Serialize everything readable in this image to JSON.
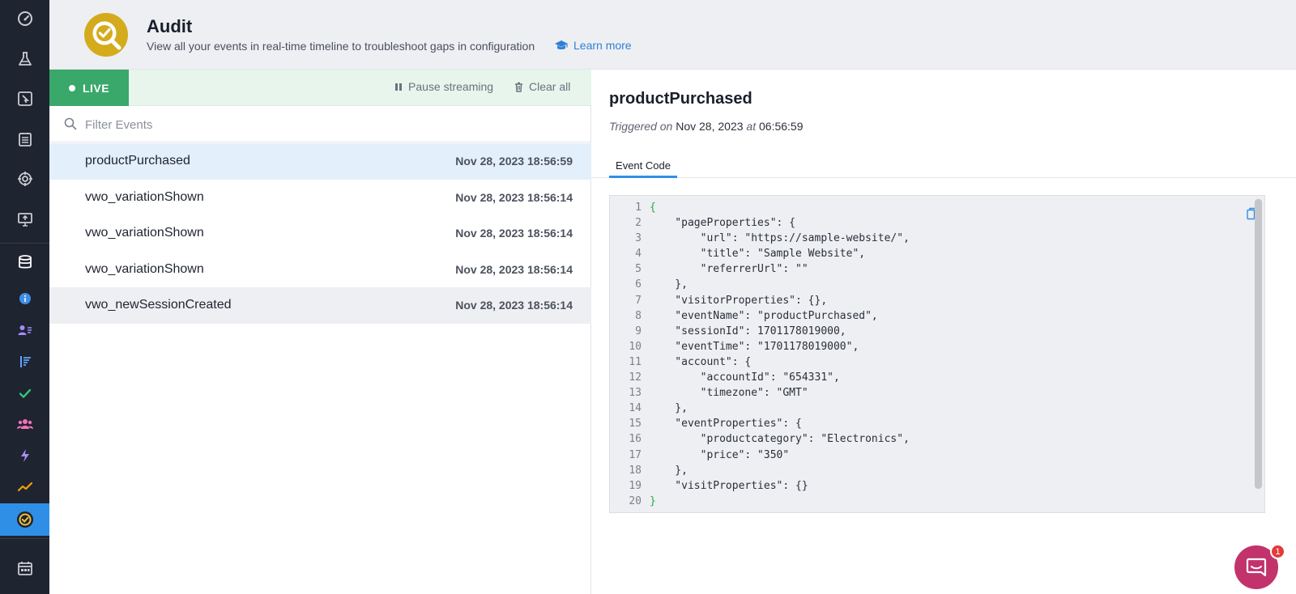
{
  "sidebar": {
    "icons": [
      {
        "name": "dashboard-icon",
        "color": "#c9ccd3"
      },
      {
        "name": "flask-icon",
        "color": "#c9ccd3"
      },
      {
        "name": "cursor-click-icon",
        "color": "#c9ccd3"
      },
      {
        "name": "list-icon",
        "color": "#c9ccd3"
      },
      {
        "name": "target-icon",
        "color": "#c9ccd3"
      },
      {
        "name": "presentation-icon",
        "color": "#c9ccd3"
      },
      {
        "name": "database-icon",
        "color": "#ffffff"
      },
      {
        "name": "info-icon",
        "color": "#3e8ee8"
      },
      {
        "name": "user-list-icon",
        "color": "#a78bfa"
      },
      {
        "name": "funnel-icon",
        "color": "#60a5fa"
      },
      {
        "name": "check-icon",
        "color": "#34c27a"
      },
      {
        "name": "users-group-icon",
        "color": "#f472b6"
      },
      {
        "name": "bolt-icon",
        "color": "#a78bfa"
      },
      {
        "name": "trend-icon",
        "color": "#f59e0b"
      },
      {
        "name": "audit-icon",
        "color": "#1e2430"
      },
      {
        "name": "calendar-icon",
        "color": "#c9ccd3"
      }
    ]
  },
  "header": {
    "title": "Audit",
    "subtitle": "View all your events in real-time timeline to troubleshoot gaps in configuration",
    "learn_more": "Learn more"
  },
  "toolbar": {
    "live_label": "LIVE",
    "pause_label": "Pause streaming",
    "clear_label": "Clear all"
  },
  "filter": {
    "placeholder": "Filter Events"
  },
  "events": [
    {
      "name": "productPurchased",
      "time": "Nov 28, 2023 18:56:59"
    },
    {
      "name": "vwo_variationShown",
      "time": "Nov 28, 2023 18:56:14"
    },
    {
      "name": "vwo_variationShown",
      "time": "Nov 28, 2023 18:56:14"
    },
    {
      "name": "vwo_variationShown",
      "time": "Nov 28, 2023 18:56:14"
    },
    {
      "name": "vwo_newSessionCreated",
      "time": "Nov 28, 2023 18:56:14"
    }
  ],
  "detail": {
    "title": "productPurchased",
    "triggered_on": "Triggered on",
    "date": "Nov 28, 2023",
    "at": "at",
    "time": "06:56:59",
    "tab_label": "Event Code",
    "code_lines": [
      "{",
      "    \"pageProperties\": {",
      "        \"url\": \"https://sample-website/\",",
      "        \"title\": \"Sample Website\",",
      "        \"referrerUrl\": \"\"",
      "    },",
      "    \"visitorProperties\": {},",
      "    \"eventName\": \"productPurchased\",",
      "    \"sessionId\": 1701178019000,",
      "    \"eventTime\": \"1701178019000\",",
      "    \"account\": {",
      "        \"accountId\": \"654331\",",
      "        \"timezone\": \"GMT\"",
      "    },",
      "    \"eventProperties\": {",
      "        \"productcategory\": \"Electronics\",",
      "        \"price\": \"350\"",
      "    },",
      "    \"visitProperties\": {}",
      "}"
    ]
  },
  "chat": {
    "badge_count": "1"
  },
  "colors": {
    "accent": "#2f8fe6",
    "live_green": "#39a86a",
    "logo_gold": "#d4ab1c",
    "chat_pink": "#c2336b"
  }
}
